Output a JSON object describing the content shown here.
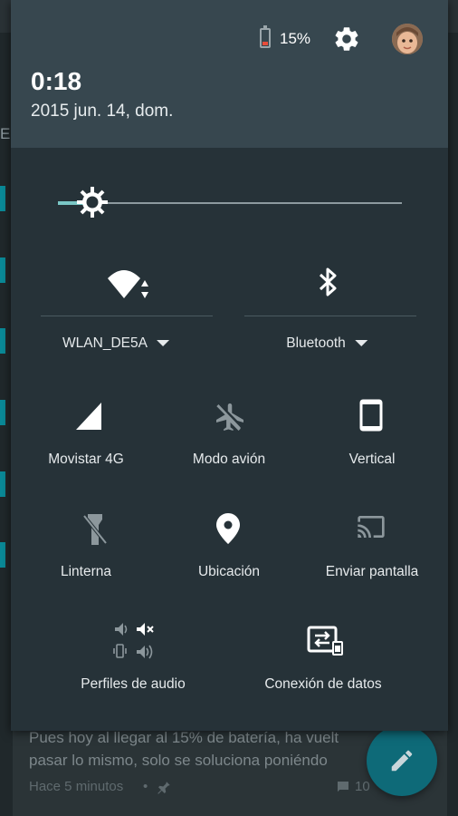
{
  "background": {
    "tab_fragment": "EN",
    "post_text_line1": "Pues hoy al llegar al 15% de batería, ha vuelt",
    "post_text_line2": "pasar lo mismo, solo se soluciona poniéndo",
    "post_time": "Hace 5 minutos",
    "post_dot": "•",
    "post_count": "10"
  },
  "header": {
    "battery_percent": "15%",
    "time": "0:18",
    "date": "2015 jun. 14, dom."
  },
  "brightness": {
    "level": 0.1
  },
  "tiles": {
    "wifi_label": "WLAN_DE5A",
    "bluetooth_label": "Bluetooth",
    "cellular_label": "Movistar 4G",
    "airplane_label": "Modo avión",
    "rotation_label": "Vertical",
    "flashlight_label": "Linterna",
    "location_label": "Ubicación",
    "cast_label": "Enviar pantalla",
    "audio_label": "Perfiles de audio",
    "data_label": "Conexión de datos"
  },
  "colors": {
    "shade": "#263238",
    "header": "#37474f",
    "accent": "#7ac7c6",
    "battery_low": "#e84d3a"
  }
}
